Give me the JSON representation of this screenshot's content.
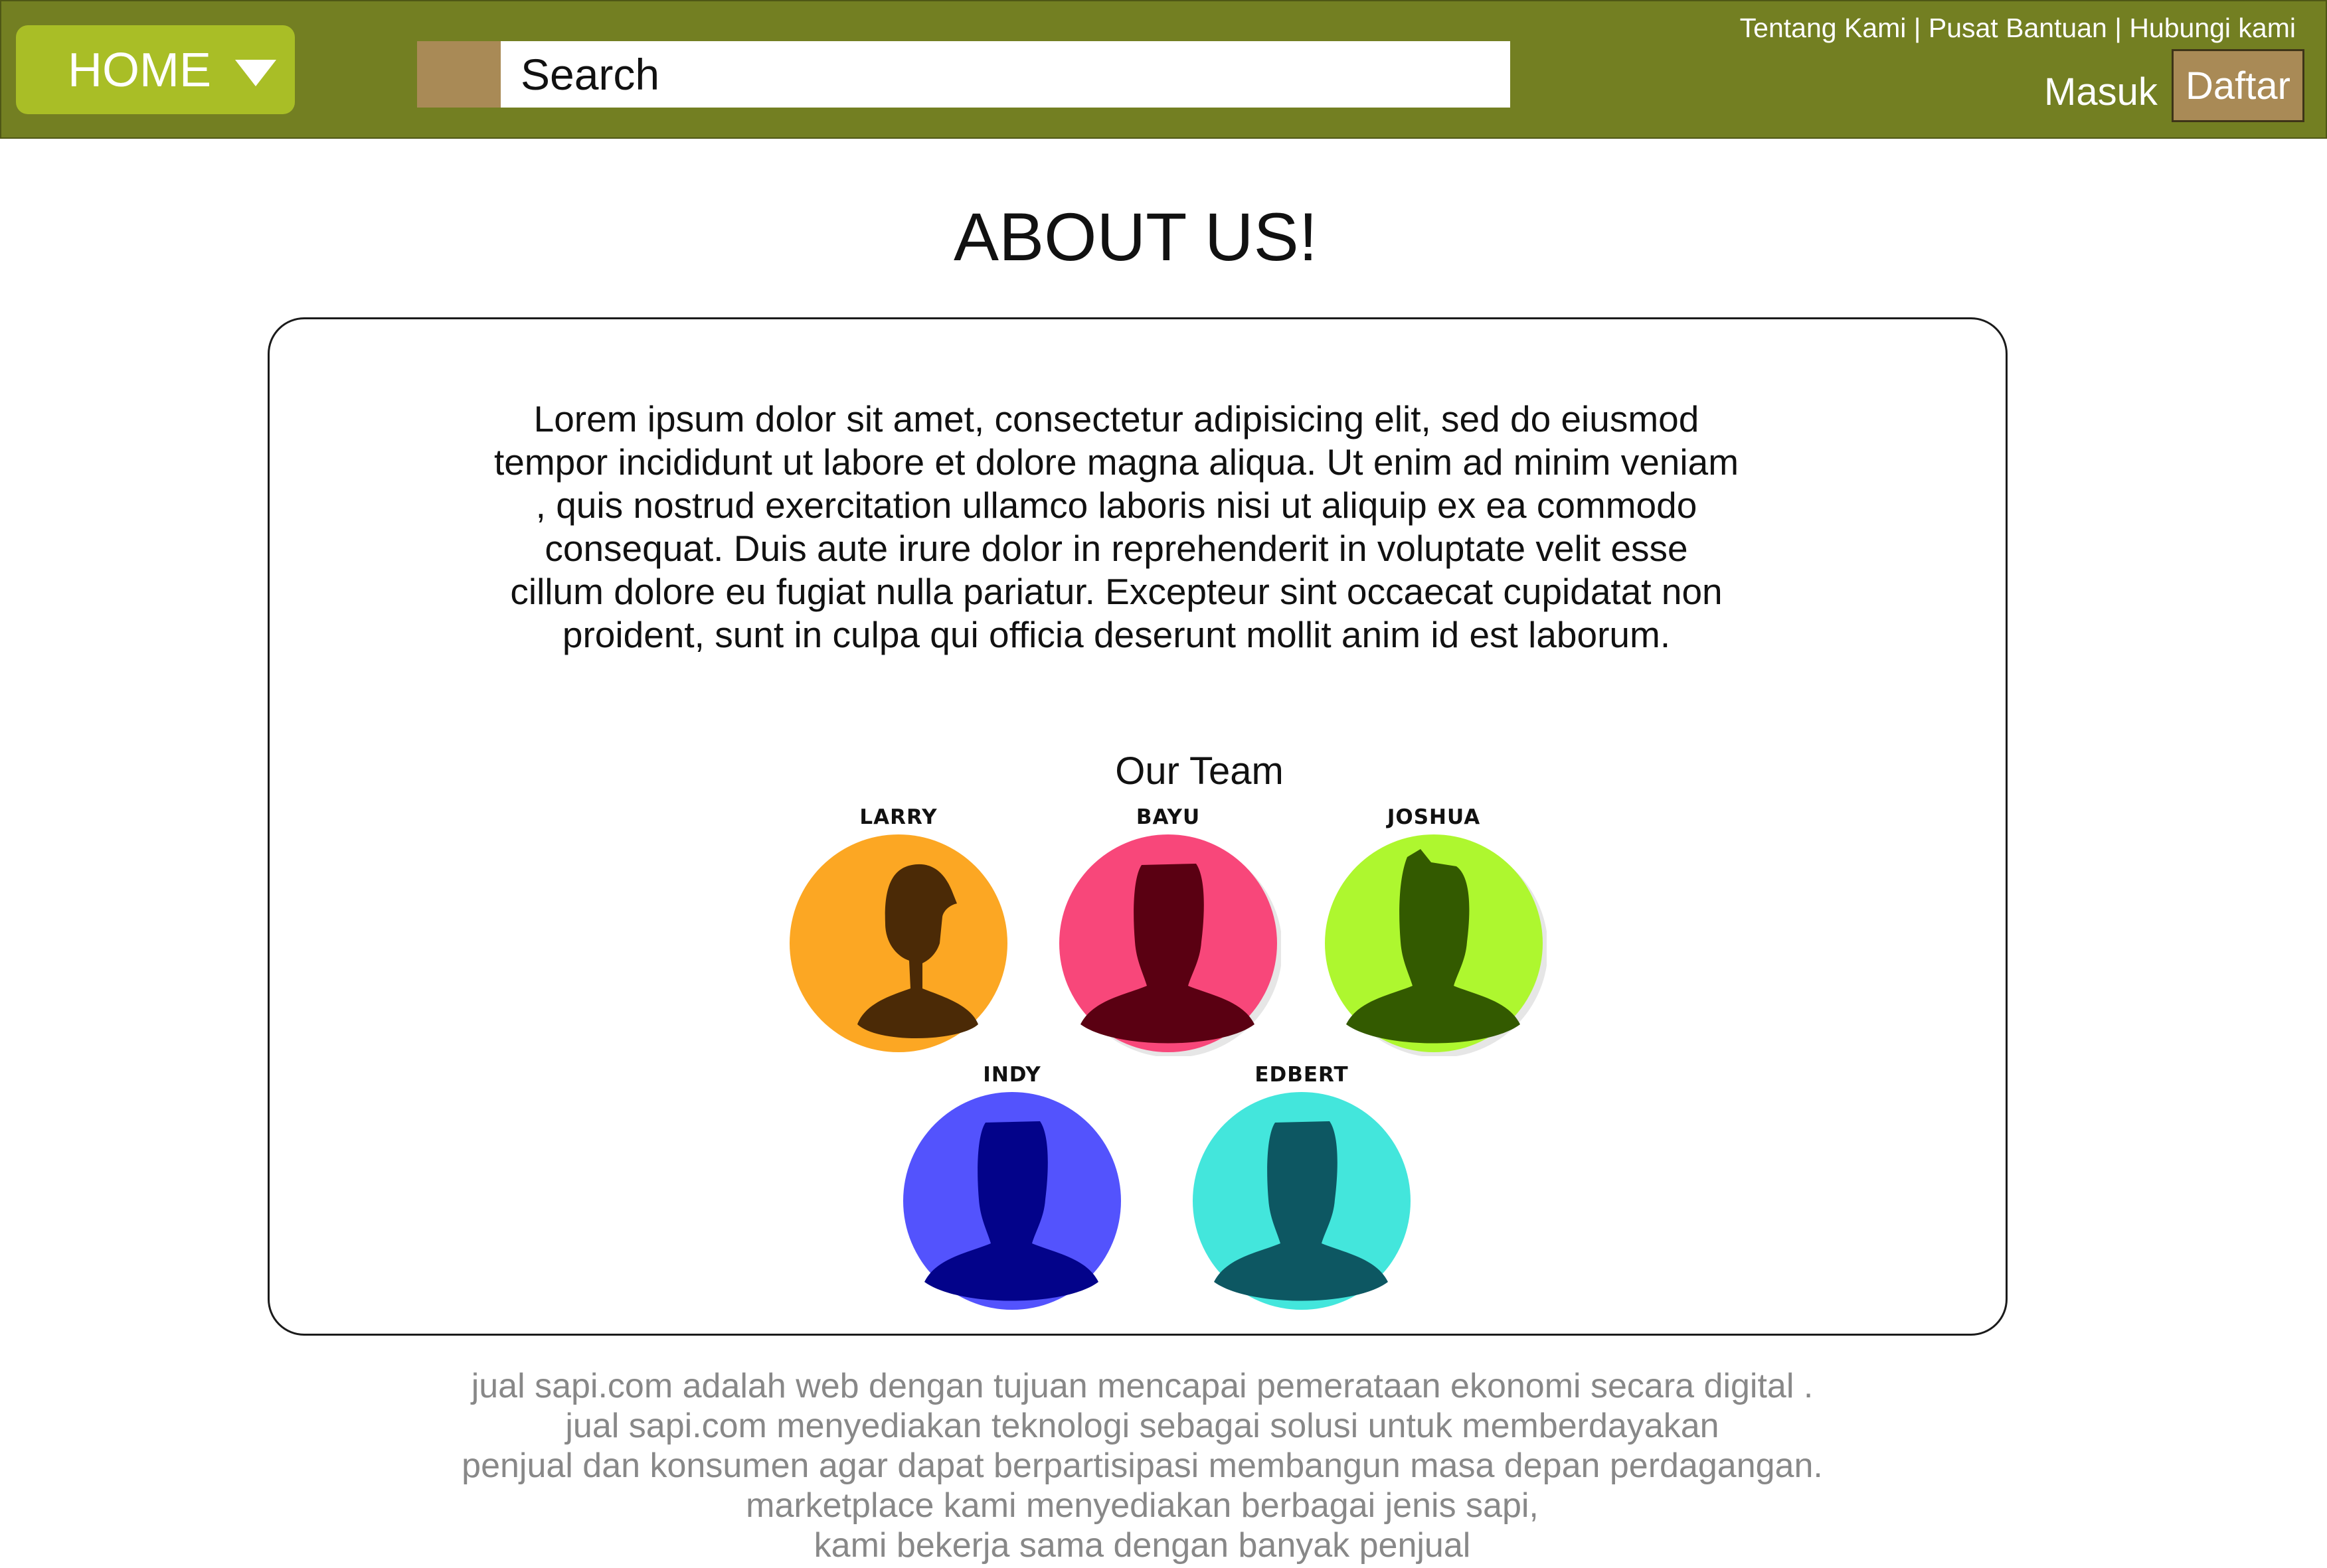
{
  "header": {
    "home_label": "HOME",
    "search_placeholder": "Search",
    "top_links": [
      "Tentang Kami",
      "Pusat Bantuan",
      "Hubungi kami"
    ],
    "separator": "|",
    "login_label": "Masuk",
    "register_label": "Daftar"
  },
  "page": {
    "title": "ABOUT US!"
  },
  "about_card": {
    "lorem_lines": [
      "Lorem ipsum dolor sit amet, consectetur adipisicing elit, sed do eiusmod",
      "tempor incididunt ut labore et dolore magna aliqua. Ut enim ad minim veniam",
      ", quis nostrud exercitation ullamco laboris nisi ut aliquip ex ea commodo",
      "consequat. Duis aute irure dolor in reprehenderit in voluptate velit esse",
      "cillum dolore eu fugiat nulla pariatur. Excepteur sint occaecat cupidatat non",
      "proident, sunt in culpa qui officia deserunt mollit anim id est laborum."
    ],
    "team_title": "Our Team",
    "members": [
      {
        "name": "LARRY",
        "bg_color": "#fca723",
        "silhouette_color": "#4b2a06",
        "icon": "person-female-icon"
      },
      {
        "name": "BAYU",
        "bg_color": "#f8477a",
        "silhouette_color": "#5a0012",
        "icon": "person-icon"
      },
      {
        "name": "JOSHUA",
        "bg_color": "#aef72f",
        "silhouette_color": "#335a00",
        "icon": "person-icon"
      },
      {
        "name": "INDY",
        "bg_color": "#5353fd",
        "silhouette_color": "#03038a",
        "icon": "person-icon"
      },
      {
        "name": "EDBERT",
        "bg_color": "#43e6dc",
        "silhouette_color": "#0d5762",
        "icon": "person-icon"
      }
    ]
  },
  "footer": {
    "about_lines": [
      "jual sapi.com adalah web dengan tujuan mencapai pemerataan ekonomi secara digital .",
      "jual sapi.com menyediakan teknologi sebagai solusi untuk memberdayakan",
      "penjual dan konsumen agar dapat berpartisipasi membangun masa depan perdagangan.",
      "marketplace kami menyediakan berbagai jenis sapi,",
      "kami bekerja sama dengan banyak penjual"
    ]
  },
  "colors": {
    "header_bg": "#737f22",
    "home_button": "#a9be26",
    "accent_brown": "#a98a56",
    "footer_text": "#888888"
  }
}
